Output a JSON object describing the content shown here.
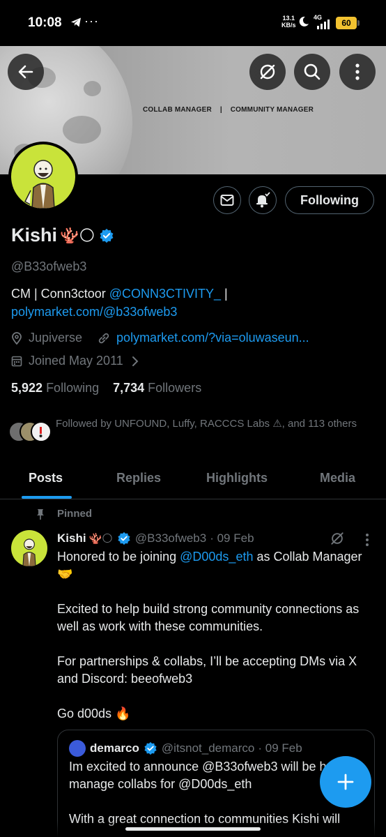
{
  "status_bar": {
    "time": "10:08",
    "more": "···",
    "net_speed_value": "13.1",
    "net_speed_unit": "KB/s",
    "network": "4G",
    "battery": "60"
  },
  "banner": {
    "text": "COLLAB MANAGER    |    COMMUNITY MANAGER"
  },
  "header": {
    "follow_label": "Following"
  },
  "profile": {
    "name": "Kishi",
    "name_emojis": "🪸🌕",
    "handle": "@B33ofweb3",
    "bio_prefix": "CM | Conn3ctoor ",
    "bio_link1": "@CONN3CTIVITY_",
    "bio_sep": " | ",
    "bio_link2": "polymarket.com/@b33ofweb3",
    "location": "Jupiverse",
    "website": "polymarket.com/?via=oluwaseun...",
    "joined": "Joined May 2011",
    "following_count": "5,922",
    "following_label": "Following",
    "followers_count": "7,734",
    "followers_label": "Followers",
    "followed_by": "Followed by UNFOUND, Luffy, RACCCS Labs ⚠, and 113 others"
  },
  "tabs": [
    "Posts",
    "Replies",
    "Highlights",
    "Media"
  ],
  "pinned_post": {
    "pinned_label": "Pinned",
    "name": "Kishi",
    "name_emojis": "🪸🌕",
    "handle": "@B33ofweb3",
    "time": "· 09 Feb",
    "line1_prefix": "Honored to be joining ",
    "line1_mention": "@D00ds_eth",
    "line1_suffix": " as Collab Manager",
    "line1_emoji": "🤝",
    "para2": "Excited to help build strong community connections as well as work with these communities.",
    "para3": "For partnerships & collabs, I’ll be accepting DMs via X and Discord: beeofweb3",
    "para4": "Go d00ds 🔥"
  },
  "quoted_post": {
    "name": "demarco",
    "handle": "@itsnot_demarco",
    "time": "· 09 Feb",
    "text": "Im excited to announce @B33ofweb3 will be helping manage collabs for @D00ds_eth",
    "text2": "With a great connection to communities Kishi will"
  },
  "colors": {
    "accent": "#1d9bf0",
    "muted": "#71767b",
    "background": "#000000",
    "avatar_bg": "#c9e33a"
  }
}
